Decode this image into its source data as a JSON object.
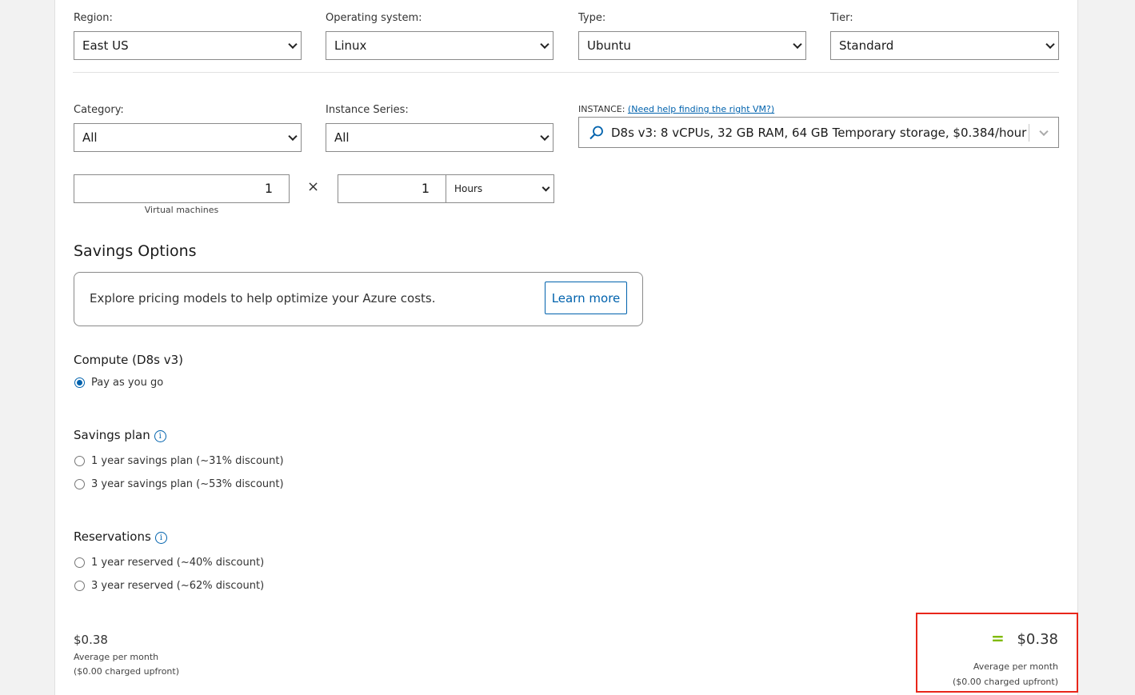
{
  "filters": {
    "region": {
      "label": "Region:",
      "value": "East US"
    },
    "os": {
      "label": "Operating system:",
      "value": "Linux"
    },
    "type": {
      "label": "Type:",
      "value": "Ubuntu"
    },
    "tier": {
      "label": "Tier:",
      "value": "Standard"
    },
    "category": {
      "label": "Category:",
      "value": "All"
    },
    "series": {
      "label": "Instance Series:",
      "value": "All"
    }
  },
  "instance": {
    "label": "INSTANCE:",
    "help_link": "(Need help finding the right VM?)",
    "value": "D8s v3: 8 vCPUs, 32 GB RAM, 64 GB Temporary storage, $0.384/hour"
  },
  "quantity": {
    "vms": "1",
    "vms_caption": "Virtual machines",
    "multiply": "×",
    "hours": "1",
    "unit": "Hours"
  },
  "savings": {
    "title": "Savings Options",
    "explore_text": "Explore pricing models to help optimize your Azure costs.",
    "learn_more": "Learn more"
  },
  "compute": {
    "title": "Compute (D8s v3)",
    "option": "Pay as you go"
  },
  "savings_plan": {
    "title": "Savings plan",
    "info": "i",
    "options": [
      "1 year savings plan (~31% discount)",
      "3 year savings plan (~53% discount)"
    ]
  },
  "reservations": {
    "title": "Reservations",
    "info": "i",
    "options": [
      "1 year reserved (~40% discount)",
      "3 year reserved (~62% discount)"
    ]
  },
  "cost_left": {
    "amount": "$0.38",
    "caption": "Average per month",
    "upfront": "($0.00 charged upfront)"
  },
  "cost_right": {
    "equals": "=",
    "amount": "$0.38",
    "caption": "Average per month",
    "upfront": "($0.00 charged upfront)"
  },
  "colors": {
    "accent": "#0062ad",
    "highlight": "#e8261a",
    "equals_green": "#7fba00"
  }
}
